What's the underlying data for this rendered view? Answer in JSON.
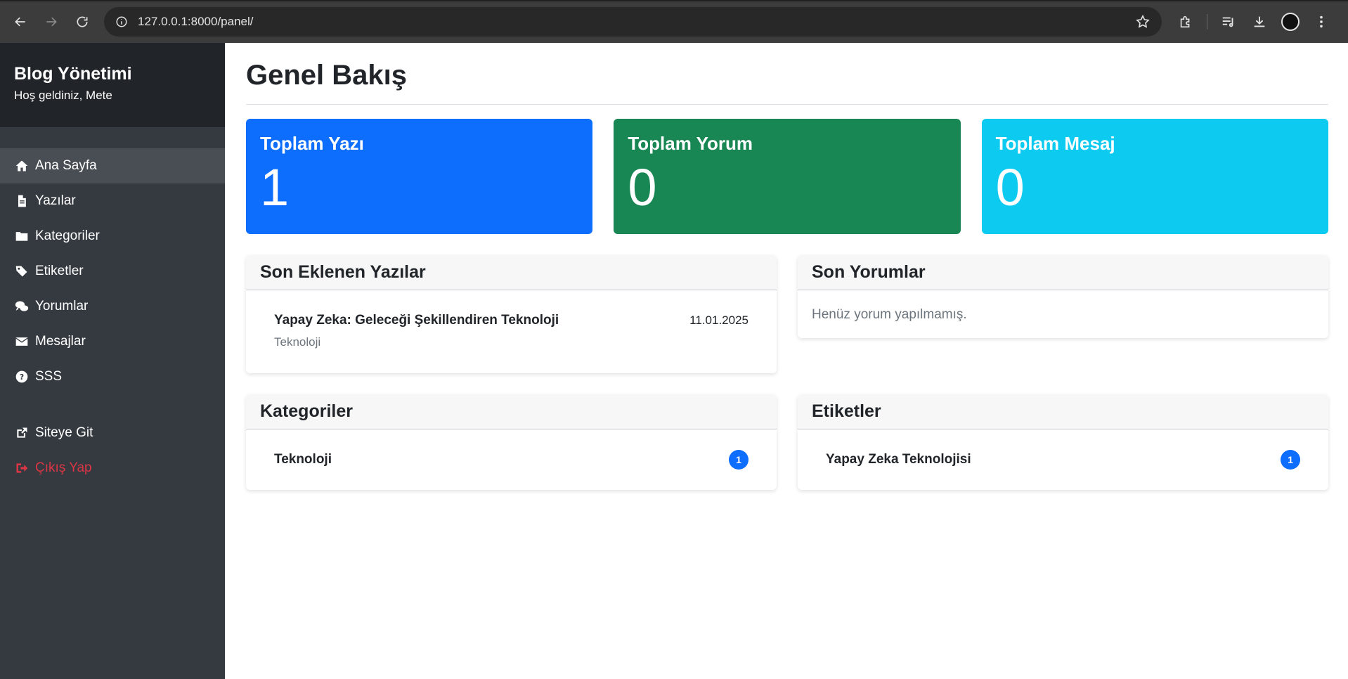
{
  "browser": {
    "url": "127.0.0.1:8000/panel/"
  },
  "sidebar": {
    "brand_title": "Blog Yönetimi",
    "brand_sub": "Hoş geldiniz, Mete",
    "items": [
      {
        "label": "Ana Sayfa",
        "icon": "home-icon",
        "active": true
      },
      {
        "label": "Yazılar",
        "icon": "file-icon"
      },
      {
        "label": "Kategoriler",
        "icon": "folder-icon"
      },
      {
        "label": "Etiketler",
        "icon": "tags-icon"
      },
      {
        "label": "Yorumlar",
        "icon": "comments-icon"
      },
      {
        "label": "Mesajlar",
        "icon": "envelope-icon"
      },
      {
        "label": "SSS",
        "icon": "question-icon"
      }
    ],
    "site_link": "Siteye Git",
    "logout": "Çıkış Yap",
    "logout_color": "#dc3545"
  },
  "main": {
    "page_title": "Genel Bakış",
    "stats": [
      {
        "title": "Toplam Yazı",
        "value": "1",
        "color": "#0d6efd"
      },
      {
        "title": "Toplam Yorum",
        "value": "0",
        "color": "#198754"
      },
      {
        "title": "Toplam Mesaj",
        "value": "0",
        "color": "#0dcaf0"
      }
    ],
    "recent_posts": {
      "header": "Son Eklenen Yazılar",
      "items": [
        {
          "title": "Yapay Zeka: Geleceği Şekillendiren Teknoloji",
          "date": "11.01.2025",
          "category": "Teknoloji"
        }
      ]
    },
    "recent_comments": {
      "header": "Son Yorumlar",
      "empty": "Henüz yorum yapılmamış."
    },
    "categories": {
      "header": "Kategoriler",
      "items": [
        {
          "label": "Teknoloji",
          "count": "1"
        }
      ]
    },
    "tags": {
      "header": "Etiketler",
      "items": [
        {
          "label": "Yapay Zeka Teknolojisi",
          "count": "1"
        }
      ]
    }
  }
}
